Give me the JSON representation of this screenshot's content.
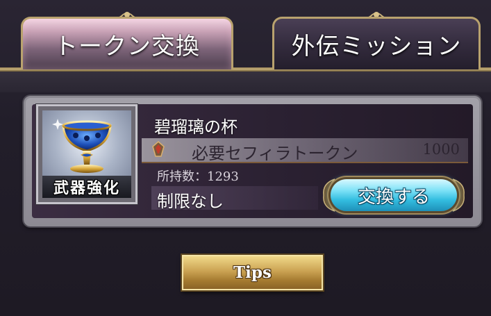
{
  "tabs": [
    {
      "label": "トークン交換",
      "active": true
    },
    {
      "label": "外伝ミッション",
      "active": false
    }
  ],
  "item": {
    "name": "碧瑠璃の杯",
    "category": "武器強化",
    "icon": "chalice-icon",
    "cost_label": "必要セフィラトークン",
    "cost_value": "1000",
    "owned_label": "所持数：",
    "owned_value": "1293",
    "limit": "制限なし",
    "exchange_label": "交換する"
  },
  "tips": {
    "label": "Tips"
  },
  "colors": {
    "accent_gold": "#b9a26e",
    "button_cyan": "#33bde0",
    "tips_gold": "#cba353"
  }
}
